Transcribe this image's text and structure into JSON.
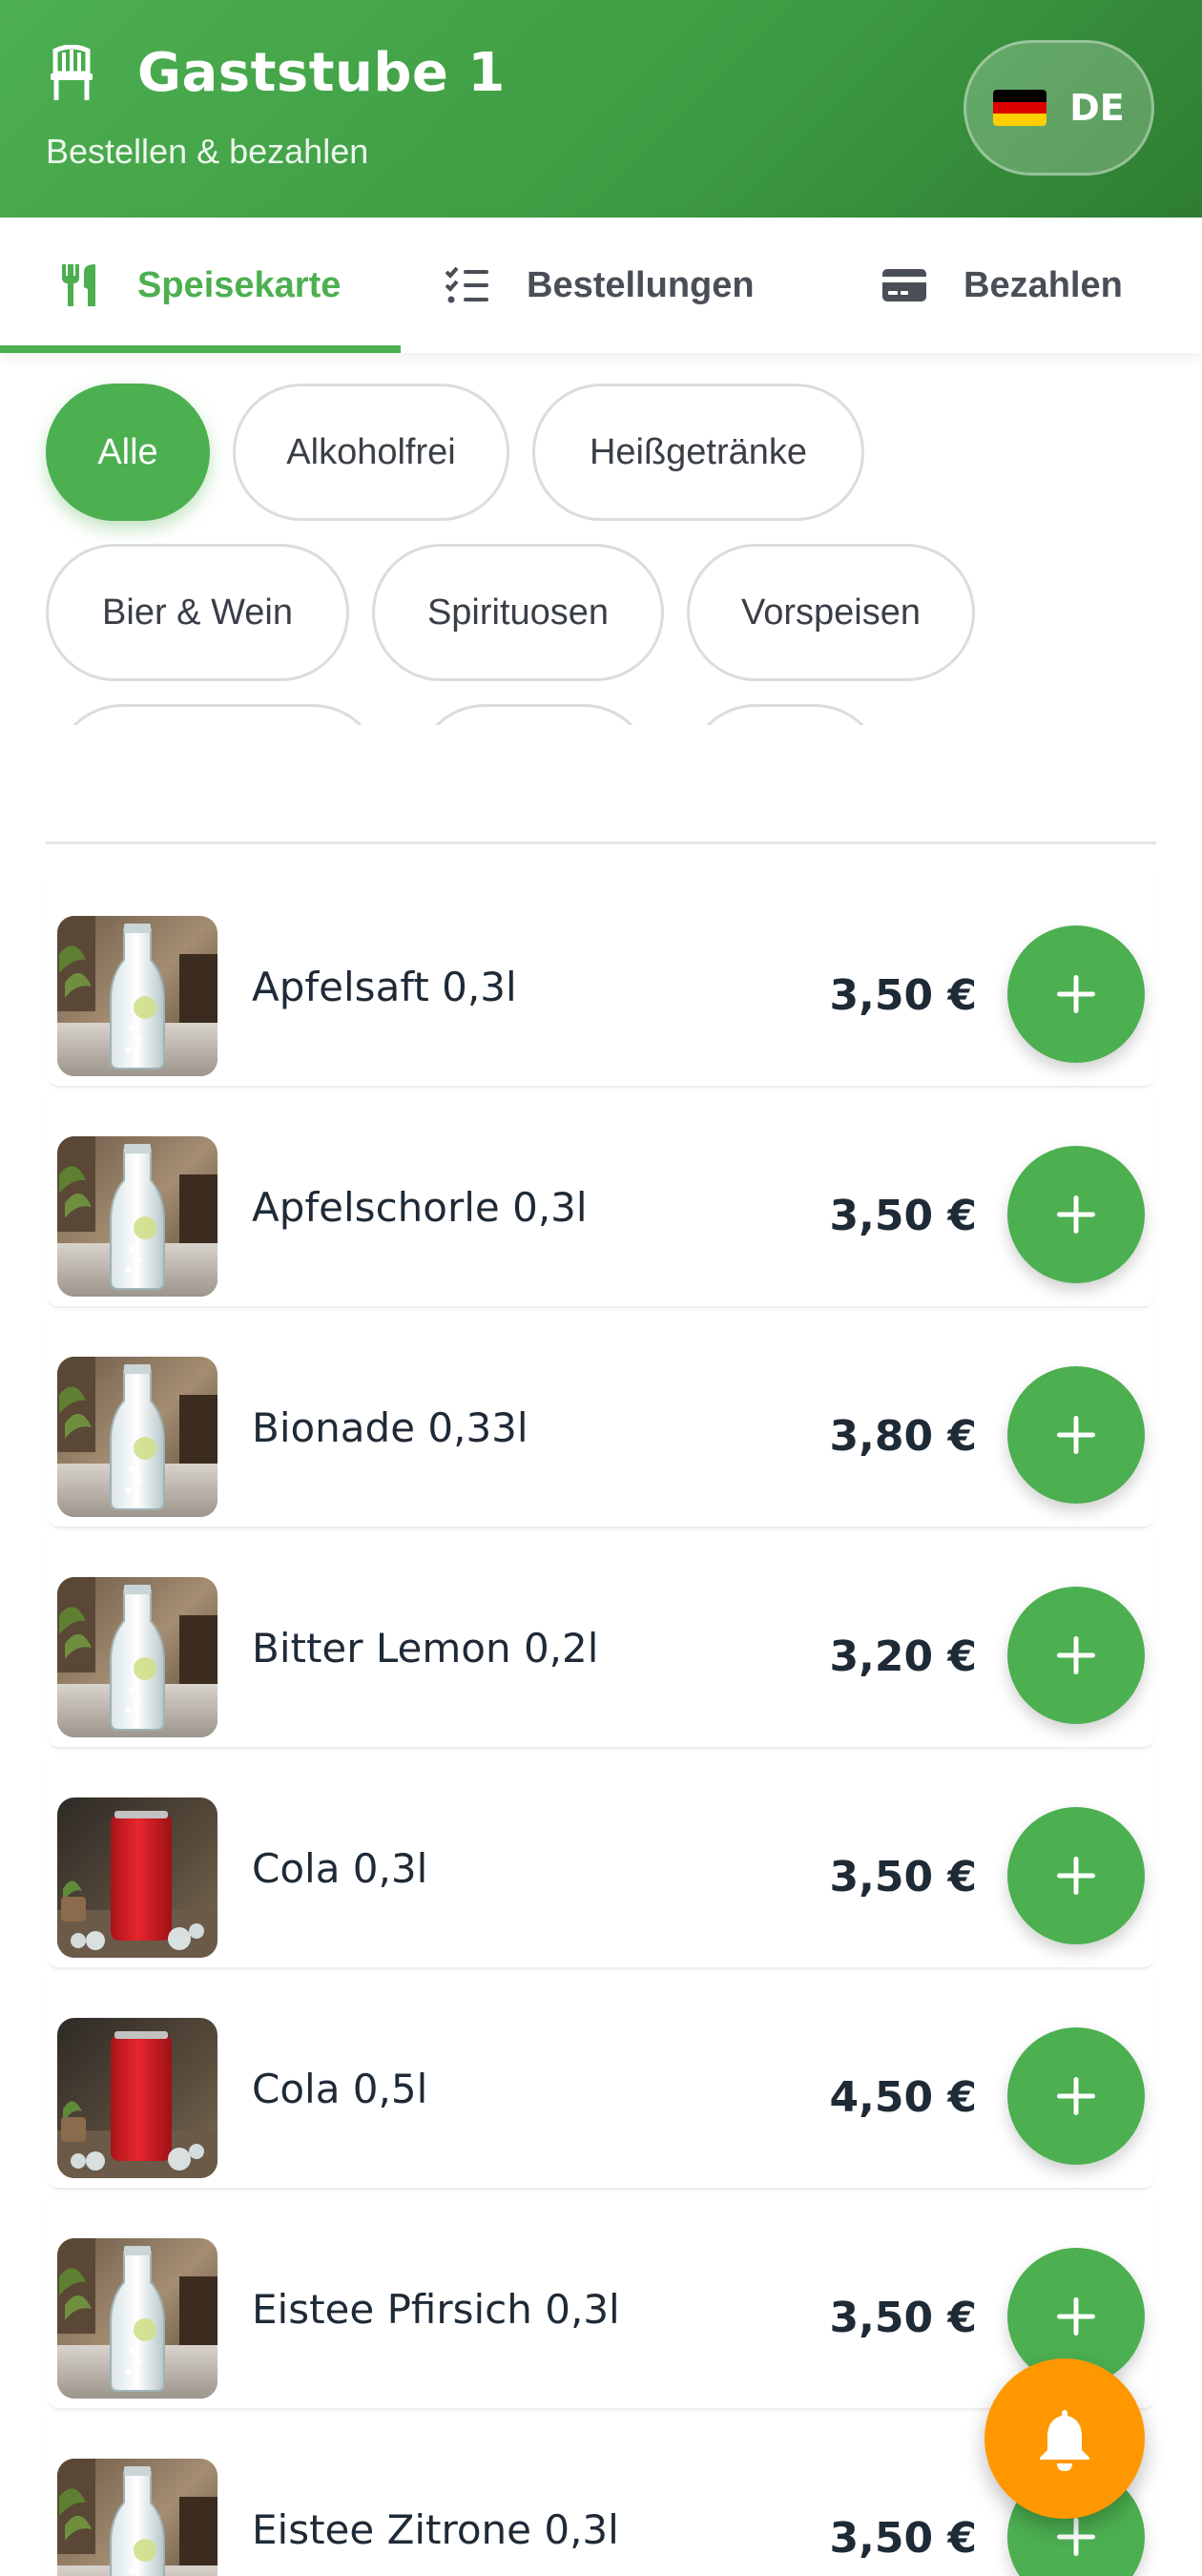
{
  "header": {
    "title": "Gaststube 1",
    "subtitle": "Bestellen & bezahlen",
    "icon": "chair-icon",
    "language_label": "DE",
    "language_flag": "german-flag-icon",
    "gradient_colors": [
      "#4caf50",
      "#2e7d32"
    ]
  },
  "tabs": [
    {
      "label": "Speisekarte",
      "icon": "fork-knife-icon",
      "active": true
    },
    {
      "label": "Bestellungen",
      "icon": "checklist-icon",
      "active": false
    },
    {
      "label": "Bezahlen",
      "icon": "credit-card-icon",
      "active": false
    }
  ],
  "categories": [
    {
      "label": "Alle",
      "active": true
    },
    {
      "label": "Alkoholfrei",
      "active": false
    },
    {
      "label": "Heißgetränke",
      "active": false
    },
    {
      "label": "Bier & Wein",
      "active": false
    },
    {
      "label": "Spirituosen",
      "active": false
    },
    {
      "label": "Vorspeisen",
      "active": false
    },
    {
      "label": "",
      "active": false
    },
    {
      "label": "",
      "active": false
    },
    {
      "label": "",
      "active": false
    }
  ],
  "items": [
    {
      "name": "Apfelsaft 0,3l",
      "price": "3,50 €",
      "image": "glass-bottle"
    },
    {
      "name": "Apfelschorle 0,3l",
      "price": "3,50 €",
      "image": "glass-bottle"
    },
    {
      "name": "Bionade 0,33l",
      "price": "3,80 €",
      "image": "glass-bottle"
    },
    {
      "name": "Bitter Lemon 0,2l",
      "price": "3,20 €",
      "image": "glass-bottle"
    },
    {
      "name": "Cola 0,3l",
      "price": "3,50 €",
      "image": "red-can"
    },
    {
      "name": "Cola 0,5l",
      "price": "4,50 €",
      "image": "red-can"
    },
    {
      "name": "Eistee Pfirsich 0,3l",
      "price": "3,50 €",
      "image": "glass-bottle"
    },
    {
      "name": "Eistee Zitrone 0,3l",
      "price": "3,50 €",
      "image": "glass-bottle"
    }
  ],
  "colors": {
    "accent": "#4caf50",
    "fab": "#ff9800",
    "text": "#1f2a37"
  },
  "fab": {
    "icon": "bell-icon"
  }
}
